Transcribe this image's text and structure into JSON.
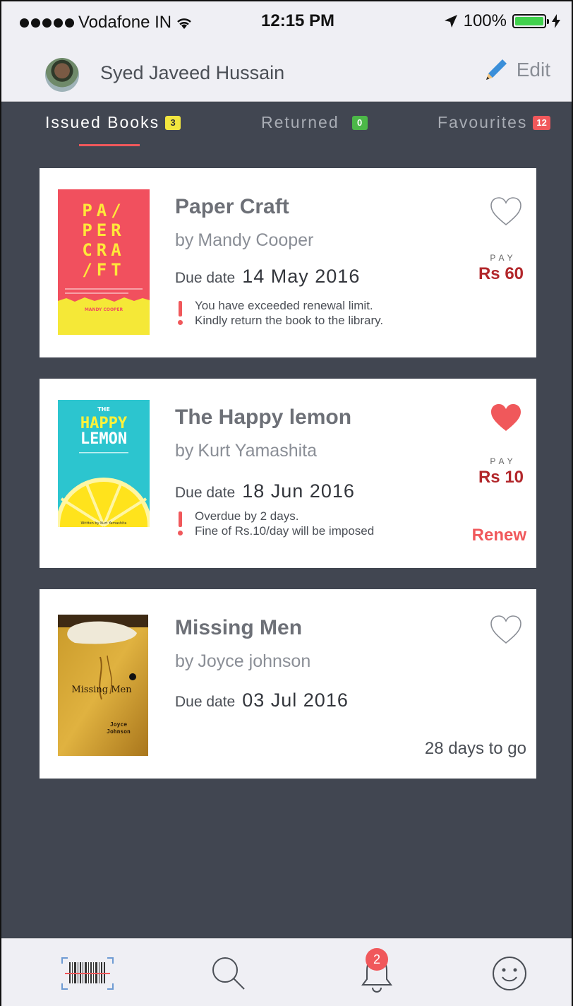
{
  "status_bar": {
    "carrier": "Vodafone IN",
    "time": "12:15 PM",
    "battery": "100%"
  },
  "header": {
    "user_name": "Syed Javeed Hussain",
    "edit_label": "Edit"
  },
  "tabs": [
    {
      "label": "Issued Books",
      "count": "3",
      "active": true
    },
    {
      "label": "Returned",
      "count": "0",
      "active": false
    },
    {
      "label": "Favourites",
      "count": "12",
      "active": false
    }
  ],
  "books": [
    {
      "title": "Paper Craft",
      "by": "by",
      "author": "Mandy Cooper",
      "due_label": "Due date",
      "due_date": "14 May 2016",
      "favourite": false,
      "pay_label": "PAY",
      "pay_amount": "Rs 60",
      "warning_lines": [
        "You have exceeded renewal limit.",
        "Kindly return the book to the library."
      ],
      "cover": {
        "lines": [
          "PA/",
          "PER",
          "CRA",
          "/FT"
        ],
        "author": "MANDY COOPER"
      }
    },
    {
      "title": "The Happy lemon",
      "by": "by",
      "author": "Kurt Yamashita",
      "due_label": "Due date",
      "due_date": "18 Jun 2016",
      "favourite": true,
      "pay_label": "PAY",
      "pay_amount": "Rs 10",
      "warning_lines": [
        "Overdue by 2 days.",
        "Fine of Rs.10/day will be imposed"
      ],
      "action_label": "Renew",
      "cover": {
        "top": "THE",
        "title1": "HAPPY",
        "title2": "LEMON",
        "byline": "Written by Kurt Yamashita"
      }
    },
    {
      "title": "Missing Men",
      "by": "by",
      "author": "Joyce johnson",
      "due_label": "Due date",
      "due_date": "03 Jul 2016",
      "favourite": false,
      "days_to_go": "28 days to go",
      "cover": {
        "title": "Missing Men",
        "author1": "Joyce",
        "author2": "Johnson"
      }
    }
  ],
  "tab_bar": {
    "notification_count": "2"
  },
  "colors": {
    "accent": "#f0585b",
    "background": "#414651",
    "bar": "#efeff4"
  }
}
